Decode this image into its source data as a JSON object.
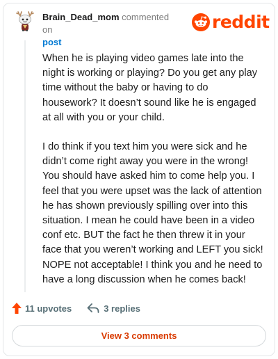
{
  "header": {
    "username": "Brain_Dead_mom",
    "commented_text": "commented on",
    "post_link": "post",
    "logo_text": "reddit"
  },
  "comment": {
    "paragraphs": [
      "When he is playing video games late into the night is working or playing? Do you get any play time without the baby or having to do housework? It doesn’t sound like he is engaged at all with you or your child.",
      "I do think if you text him you were sick and he didn’t come right away you were in the wrong! You should have asked him to come help you. I feel that you were upset was the lack of attention he has shown previously spilling over into this situation. I mean he could have been in a video conf etc. BUT the fact he then threw it in your face that you weren’t working and LEFT you sick! NOPE not acceptable! I think you and he need to have a long discussion when he comes back!"
    ]
  },
  "actions": {
    "upvotes": "11 upvotes",
    "replies": "3 replies",
    "upvote_icon": "upvote-arrow-icon",
    "reply_icon": "reply-arrow-icon"
  },
  "footer": {
    "view_comments": "View 3 comments"
  },
  "colors": {
    "brand": "#ff4500",
    "link": "#0079d3",
    "button_text": "#d93a00"
  }
}
